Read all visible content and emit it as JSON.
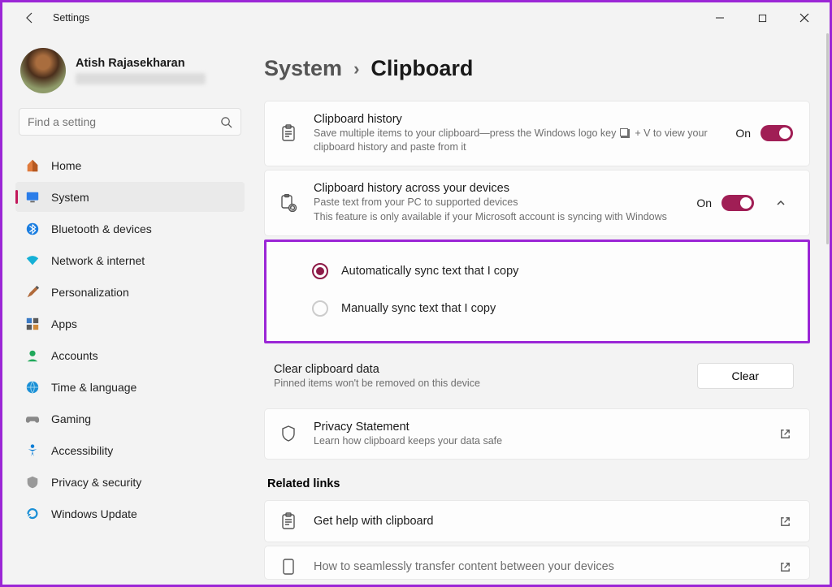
{
  "titlebar": {
    "title": "Settings"
  },
  "profile": {
    "name": "Atish Rajasekharan"
  },
  "search": {
    "placeholder": "Find a setting"
  },
  "nav": [
    {
      "id": "home",
      "label": "Home"
    },
    {
      "id": "system",
      "label": "System"
    },
    {
      "id": "bluetooth",
      "label": "Bluetooth & devices"
    },
    {
      "id": "network",
      "label": "Network & internet"
    },
    {
      "id": "personalization",
      "label": "Personalization"
    },
    {
      "id": "apps",
      "label": "Apps"
    },
    {
      "id": "accounts",
      "label": "Accounts"
    },
    {
      "id": "time",
      "label": "Time & language"
    },
    {
      "id": "gaming",
      "label": "Gaming"
    },
    {
      "id": "accessibility",
      "label": "Accessibility"
    },
    {
      "id": "privacy",
      "label": "Privacy & security"
    },
    {
      "id": "update",
      "label": "Windows Update"
    }
  ],
  "breadcrumb": {
    "parent": "System",
    "sep": "›",
    "current": "Clipboard"
  },
  "history": {
    "title": "Clipboard history",
    "desc_pre": "Save multiple items to your clipboard—press the Windows logo key ",
    "desc_post": " + V to view your clipboard history and paste from it",
    "toggle_label": "On"
  },
  "sync": {
    "title": "Clipboard history across your devices",
    "desc1": "Paste text from your PC to supported devices",
    "desc2": "This feature is only available if your Microsoft account is syncing with Windows",
    "toggle_label": "On",
    "opt_auto": "Automatically sync text that I copy",
    "opt_manual": "Manually sync text that I copy"
  },
  "clear": {
    "title": "Clear clipboard data",
    "desc": "Pinned items won't be removed on this device",
    "button": "Clear"
  },
  "privacy": {
    "title": "Privacy Statement",
    "desc": "Learn how clipboard keeps your data safe"
  },
  "related": {
    "heading": "Related links",
    "help": "Get help with clipboard",
    "transfer": "How to seamlessly transfer content between your devices"
  }
}
